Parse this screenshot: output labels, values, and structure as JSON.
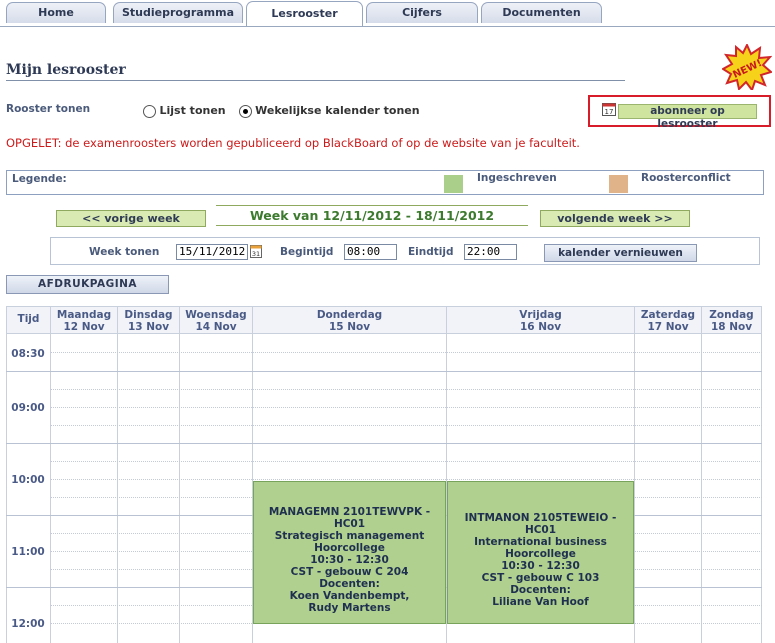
{
  "tabs": [
    {
      "label": "Home"
    },
    {
      "label": "Studieprogramma"
    },
    {
      "label": "Lesrooster"
    },
    {
      "label": "Cijfers"
    },
    {
      "label": "Documenten"
    }
  ],
  "page_title": "Mijn lesrooster",
  "new_badge": "NEW!",
  "view": {
    "label": "Rooster tonen",
    "options": [
      {
        "label": "Lijst tonen",
        "checked": false
      },
      {
        "label": "Wekelijkse kalender tonen",
        "checked": true
      }
    ]
  },
  "subscribe": {
    "label": "abonneer op lesrooster",
    "icon": "calendar-icon",
    "highlight_color": "#d81c2a"
  },
  "warning": "OPGELET:  de examenroosters worden gepubliceerd op BlackBoard of op de website van je faculteit.",
  "legend": {
    "label": "Legende:",
    "items": [
      {
        "label": "Ingeschreven",
        "color": "#a9cf8b"
      },
      {
        "label": "Roosterconflict",
        "color": "#e0b488"
      }
    ]
  },
  "week_nav": {
    "prev": "<< vorige week",
    "range": "Week van 12/11/2012 - 18/11/2012",
    "next": "volgende week >>"
  },
  "week_form": {
    "week_label": "Week tonen",
    "week_value": "15/11/2012",
    "start_label": "Begintijd",
    "start_value": "08:00",
    "end_label": "Eindtijd",
    "end_value": "22:00",
    "refresh": "kalender vernieuwen"
  },
  "print_label": "AFDRUKPAGINA",
  "calendar": {
    "time_header": "Tijd",
    "days": [
      {
        "name": "Maandag",
        "date": "12 Nov"
      },
      {
        "name": "Dinsdag",
        "date": "13 Nov"
      },
      {
        "name": "Woensdag",
        "date": "14 Nov"
      },
      {
        "name": "Donderdag",
        "date": "15 Nov"
      },
      {
        "name": "Vrijdag",
        "date": "16 Nov"
      },
      {
        "name": "Zaterdag",
        "date": "17 Nov"
      },
      {
        "name": "Zondag",
        "date": "18 Nov"
      }
    ],
    "times": [
      "08:30",
      "09:00",
      "10:00",
      "11:00",
      "12:00"
    ],
    "events": [
      {
        "day": "Donderdag",
        "lines": [
          "MANAGEMN 2101TEWVPK - HC01",
          "Strategisch management",
          "Hoorcollege",
          "10:30 - 12:30",
          "CST - gebouw C 204",
          "Docenten:",
          "Koen Vandenbempt,",
          "Rudy Martens"
        ]
      },
      {
        "day": "Vrijdag",
        "lines": [
          "INTMANON 2105TEWEIO - HC01",
          "International business",
          "Hoorcollege",
          "10:30 - 12:30",
          "CST - gebouw C 103",
          "Docenten:",
          "Liliane Van Hoof"
        ]
      }
    ]
  }
}
